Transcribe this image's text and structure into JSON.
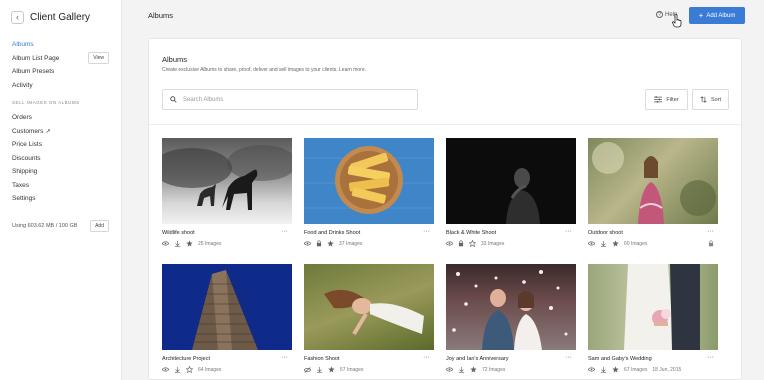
{
  "sidebar": {
    "title": "Client Gallery",
    "back_icon": "chevron-left-icon",
    "items": [
      {
        "label": "Albums",
        "active": true
      },
      {
        "label": "Album List Page",
        "button": "View"
      },
      {
        "label": "Album Presets"
      },
      {
        "label": "Activity"
      }
    ],
    "section_label": "SELL IMAGES ON ALBUMS",
    "sell_items": [
      {
        "label": "Orders"
      },
      {
        "label": "Customers",
        "external": true
      },
      {
        "label": "Price Lists"
      },
      {
        "label": "Discounts"
      },
      {
        "label": "Shipping"
      },
      {
        "label": "Taxes"
      },
      {
        "label": "Settings"
      }
    ],
    "storage_text": "Using 603.62 MB / 100 GB",
    "storage_button": "Add"
  },
  "topbar": {
    "title": "Albums",
    "help_label": "Help",
    "add_button_label": "Add Album",
    "accent": "#3a7bd5"
  },
  "panel": {
    "title": "Albums",
    "subtitle": "Create exclusive Albums to share, proof, deliver and sell images to your clients. Learn more.",
    "search_placeholder": "Search Albums",
    "filter_label": "Filter",
    "sort_label": "Sort"
  },
  "albums": [
    {
      "title": "Wildlife shoot",
      "count": "25 Images",
      "date": "",
      "icons": [
        "eye-icon",
        "download-icon",
        "star-icon"
      ]
    },
    {
      "title": "Food and Drinks Shoot",
      "count": "37 Images",
      "date": "",
      "icons": [
        "eye-icon",
        "lock-icon",
        "star-icon"
      ]
    },
    {
      "title": "Black & White Shoot",
      "count": "33 Images",
      "date": "",
      "icons": [
        "eye-icon",
        "lock-icon",
        "star-outline-icon"
      ]
    },
    {
      "title": "Outdoor shoot",
      "count": "60 Images",
      "date": "",
      "icons": [
        "eye-icon",
        "download-icon",
        "star-icon"
      ],
      "locked": true
    },
    {
      "title": "Architecture Project",
      "count": "64 Images",
      "date": "",
      "icons": [
        "eye-icon",
        "download-icon",
        "star-outline-icon"
      ]
    },
    {
      "title": "Fashion Shoot",
      "count": "57 Images",
      "date": "",
      "icons": [
        "eye-off-icon",
        "download-icon",
        "star-icon"
      ]
    },
    {
      "title": "Joy and Ian's Anniversary",
      "count": "72 Images",
      "date": "",
      "icons": [
        "eye-icon",
        "download-icon",
        "star-icon"
      ]
    },
    {
      "title": "Sam and Gaby's Wedding",
      "count": "67 Images",
      "date": "18 Jun, 2015",
      "icons": [
        "eye-icon",
        "download-icon",
        "star-icon"
      ]
    }
  ]
}
